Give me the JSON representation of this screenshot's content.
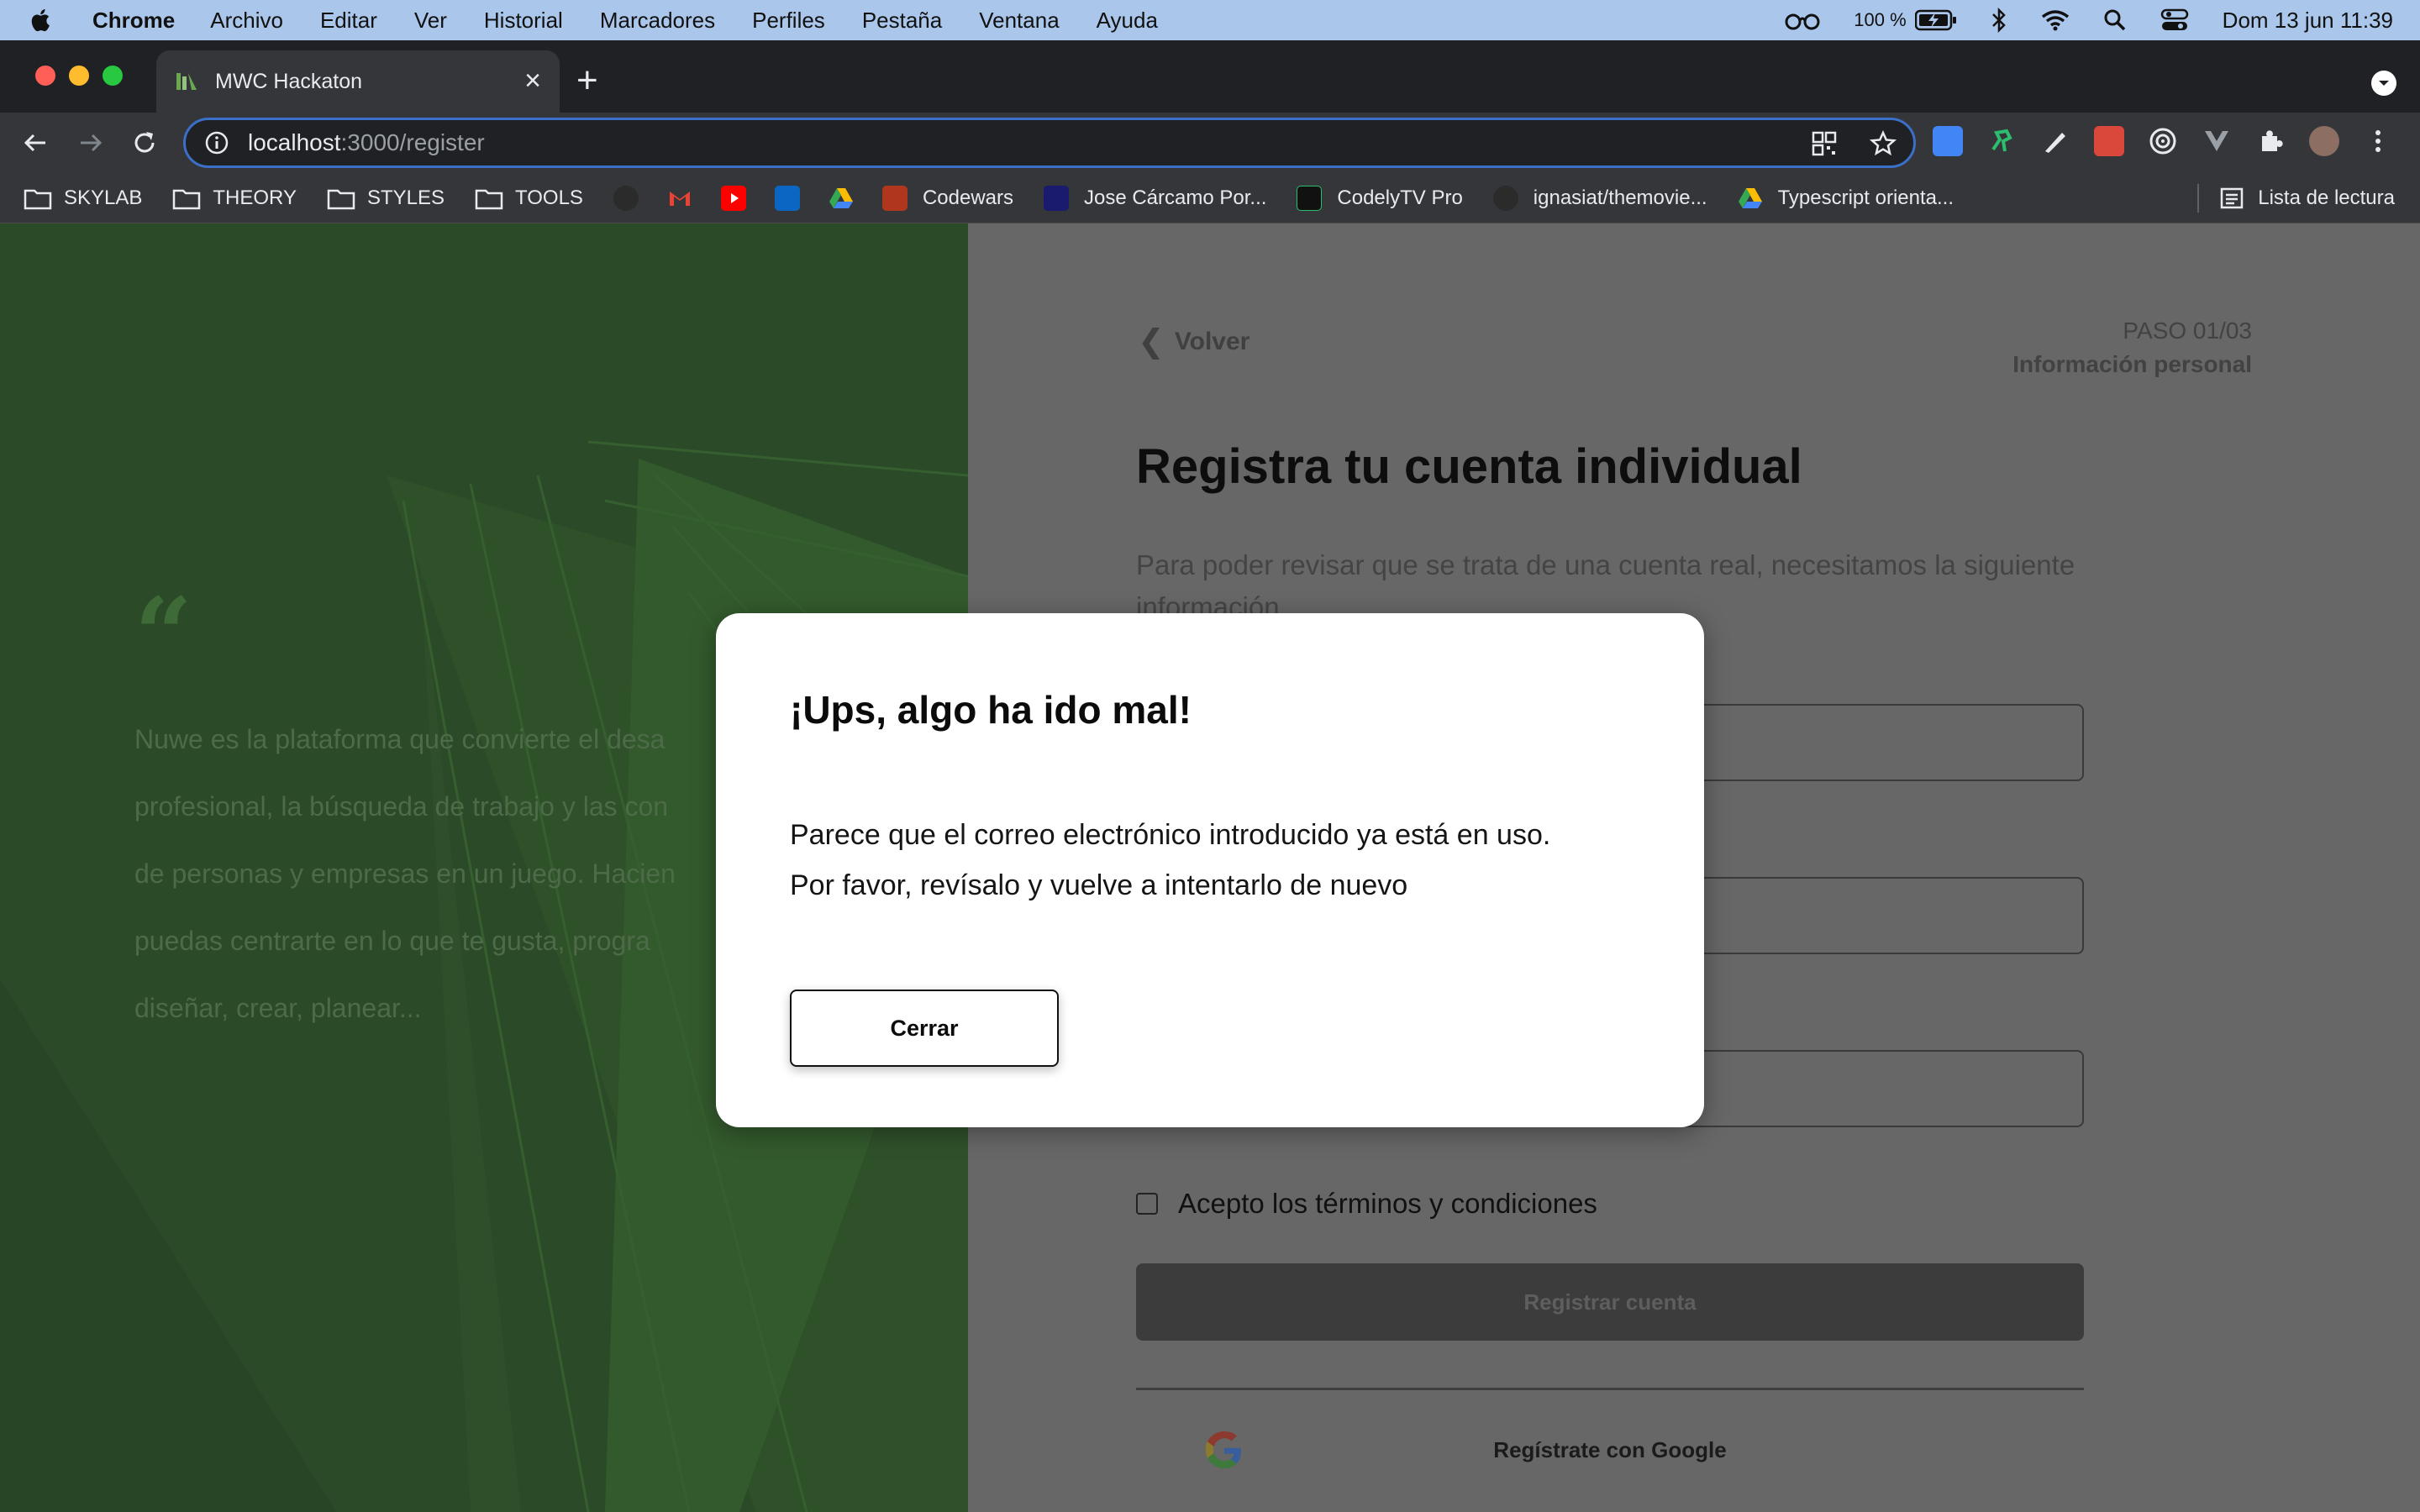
{
  "menubar": {
    "app_name": "Chrome",
    "items": [
      "Archivo",
      "Editar",
      "Ver",
      "Historial",
      "Marcadores",
      "Perfiles",
      "Pestaña",
      "Ventana",
      "Ayuda"
    ],
    "battery_percent": "100 %",
    "datetime": "Dom 13 jun  11:39"
  },
  "browser": {
    "tab_title": "MWC Hackaton",
    "url_host": "localhost",
    "url_path": ":3000/register",
    "bookmarks": {
      "folders": [
        "SKYLAB",
        "THEORY",
        "STYLES",
        "TOOLS"
      ],
      "codewars": "Codewars",
      "jose": "Jose Cárcamo Por...",
      "codelytv": "CodelyTV Pro",
      "ignasiat": "ignasiat/themovie...",
      "typescript": "Typescript orienta..."
    },
    "reading_list": "Lista de lectura"
  },
  "left_panel": {
    "quote_mark": "“",
    "quote_lines": [
      "Nuwe es la plataforma que convierte el desa",
      "profesional, la búsqueda de trabajo y las con",
      "de personas y empresas en un juego. Hacien",
      "puedas centrarte en lo que te gusta, progra",
      "diseñar, crear, planear..."
    ]
  },
  "register": {
    "back_label": "Volver",
    "step_number": "PASO 01/03",
    "step_label": "Información personal",
    "title": "Registra tu cuenta individual",
    "description": "Para poder revisar que se trata de una cuenta real, necesitamos la siguiente información",
    "terms_label": "Acepto los términos y condiciones",
    "submit_label": "Registrar cuenta",
    "google_label": "Regístrate con Google"
  },
  "modal": {
    "title": "¡Ups, algo ha ido mal!",
    "line1": "Parece que el correo electrónico introducido ya está en uso.",
    "line2": "Por favor, revísalo y vuelve a intentarlo de nuevo",
    "close_label": "Cerrar"
  },
  "colors": {
    "modal_bg": "#ffffff",
    "overlay_left": "#2b4a28",
    "overlay_right": "#676767",
    "omnibox_focus": "#3b6fc8"
  }
}
